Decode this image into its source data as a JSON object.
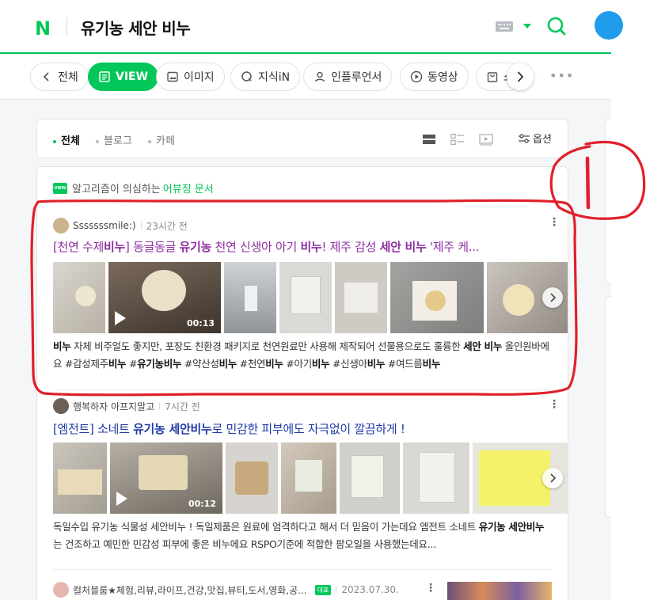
{
  "header": {
    "logo": "N",
    "query": "유기농 세안 비누"
  },
  "tabs": [
    {
      "label": "전체",
      "icon": "chevron-left-icon"
    },
    {
      "label": "VIEW",
      "icon": "document-icon",
      "active": true
    },
    {
      "label": "이미지",
      "icon": "image-icon"
    },
    {
      "label": "지식iN",
      "icon": "q-icon"
    },
    {
      "label": "인플루언서",
      "icon": "person-icon"
    },
    {
      "label": "동영상",
      "icon": "play-icon"
    },
    {
      "label": "쇼",
      "icon": "bag-icon"
    }
  ],
  "filters": {
    "items": [
      "전체",
      "블로그",
      "카페"
    ],
    "options_label": "옵션"
  },
  "notice": {
    "prefix": "알고리즘이 의심하는",
    "highlight": "어뷰징 문서",
    "badge": "VIEW"
  },
  "results": [
    {
      "author": "Sssssssmile:)",
      "time": "23시간 전",
      "title_parts": [
        {
          "t": "[천연 수제",
          "b": false
        },
        {
          "t": "비누",
          "b": true
        },
        {
          "t": "] 동글동글 ",
          "b": false
        },
        {
          "t": "유기농",
          "b": true
        },
        {
          "t": " 천연 신생아 아기 ",
          "b": false
        },
        {
          "t": "비누",
          "b": true
        },
        {
          "t": "! 제주 감성 ",
          "b": false
        },
        {
          "t": "세안 비누",
          "b": true
        },
        {
          "t": " '제주 케...",
          "b": false
        }
      ],
      "title_color": "#8e2ea0",
      "video_duration": "00:13",
      "desc_parts": [
        {
          "t": "비누",
          "b": true
        },
        {
          "t": " 자체 비주얼도 좋지만, 포장도 친환경 패키지로 천연원료만 사용해 제작되어 선물용으로도 훌륭한 ",
          "b": false
        },
        {
          "t": "세안 비누",
          "b": true
        },
        {
          "t": " 올인원바에요 #감성제주",
          "b": false
        },
        {
          "t": "비누",
          "b": true
        },
        {
          "t": " #",
          "b": false
        },
        {
          "t": "유기농비누",
          "b": true
        },
        {
          "t": " #약산성",
          "b": false
        },
        {
          "t": "비누",
          "b": true
        },
        {
          "t": " #천연",
          "b": false
        },
        {
          "t": "비누",
          "b": true
        },
        {
          "t": " #아기",
          "b": false
        },
        {
          "t": "비누",
          "b": true
        },
        {
          "t": " #신생아",
          "b": false
        },
        {
          "t": "비누",
          "b": true
        },
        {
          "t": " #여드름",
          "b": false
        },
        {
          "t": "비누",
          "b": true
        }
      ]
    },
    {
      "author": "행복하자 아프지말고",
      "time": "7시간 전",
      "title_parts": [
        {
          "t": "[엠전트] 소네트 ",
          "b": false
        },
        {
          "t": "유기농 세안비누",
          "b": true
        },
        {
          "t": "로 민감한 피부에도 자극없이 깔끔하게 !",
          "b": false
        }
      ],
      "title_color": "#1f3aa8",
      "video_duration": "00:12",
      "desc_parts": [
        {
          "t": "독일수입 유기농 식물성 세안비누 ! 독일제품은 원료에 엄격하다고 해서 더 믿음이 가는데요 엠전트 소네트 ",
          "b": false
        },
        {
          "t": "유기농 세안비누",
          "b": true
        },
        {
          "t": "는 건조하고 예민한 민감성 피부에 좋은 비누에요 RSPO기준에 적합한 팜오일을 사용했는데요...",
          "b": false
        }
      ]
    },
    {
      "author": "컬처블룸★체험,리뷰,라이프,건강,맛집,뷰티,도서,영화,공...",
      "badge": "대표",
      "time": "2023.07.30."
    }
  ],
  "colors": {
    "brand": "#03c75a",
    "annotation": "#e0202a"
  },
  "annotation_label": "1"
}
